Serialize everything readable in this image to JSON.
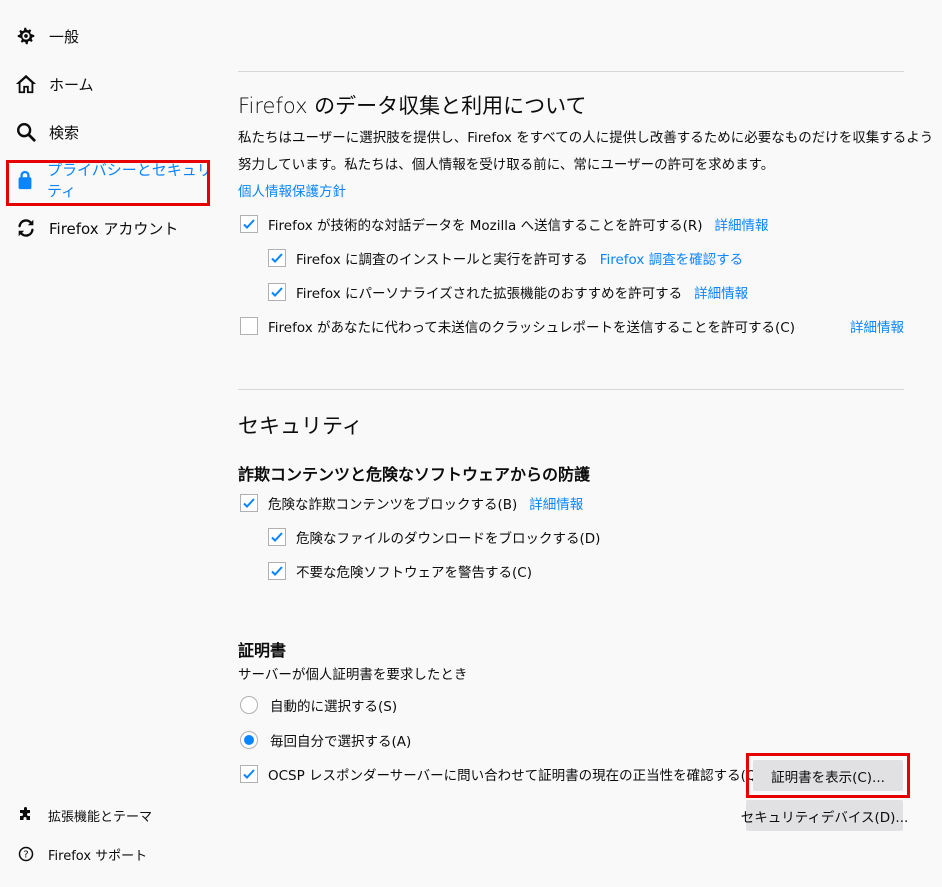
{
  "sidebar": {
    "items": [
      {
        "label": "一般",
        "icon": "gear-icon"
      },
      {
        "label": "ホーム",
        "icon": "home-icon"
      },
      {
        "label": "検索",
        "icon": "search-icon"
      },
      {
        "label": "プライバシーとセキュリティ",
        "icon": "lock-icon"
      },
      {
        "label": "Firefox アカウント",
        "icon": "sync-icon"
      }
    ],
    "footer": [
      {
        "label": "拡張機能とテーマ",
        "icon": "puzzle-icon"
      },
      {
        "label": "Firefox サポート",
        "icon": "help-icon"
      }
    ]
  },
  "data_collection": {
    "title": "Firefox のデータ収集と利用について",
    "desc_line1": "私たちはユーザーに選択肢を提供し、Firefox をすべての人に提供し改善するために必要なものだけを収集するよう",
    "desc_line2": "努力しています。私たちは、個人情報を受け取る前に、常にユーザーの許可を求めます。",
    "privacy_link": "個人情報保護方針",
    "telemetry": {
      "label": "Firefox が技術的な対話データを Mozilla へ送信することを許可する(R)",
      "link": "詳細情報",
      "checked": true
    },
    "studies": {
      "label": "Firefox に調査のインストールと実行を許可する",
      "link": "Firefox 調査を確認する",
      "checked": true
    },
    "recommend": {
      "label": "Firefox にパーソナライズされた拡張機能のおすすめを許可する",
      "link": "詳細情報",
      "checked": true
    },
    "crash": {
      "label": "Firefox があなたに代わって未送信のクラッシュレポートを送信することを許可する(C)",
      "link": "詳細情報",
      "checked": false
    }
  },
  "security": {
    "title": "セキュリティ",
    "phishing_title": "詐欺コンテンツと危険なソフトウェアからの防護",
    "block_deceptive": {
      "label": "危険な詐欺コンテンツをブロックする(B)",
      "link": "詳細情報",
      "checked": true
    },
    "block_downloads": {
      "label": "危険なファイルのダウンロードをブロックする(D)",
      "checked": true
    },
    "warn_unwanted": {
      "label": "不要な危険ソフトウェアを警告する(C)",
      "checked": true
    }
  },
  "certificates": {
    "title": "証明書",
    "subtitle": "サーバーが個人証明書を要求したとき",
    "auto_select": {
      "label": "自動的に選択する(S)",
      "selected": false
    },
    "ask_every": {
      "label": "毎回自分で選択する(A)",
      "selected": true
    },
    "ocsp": {
      "label": "OCSP レスポンダーサーバーに問い合わせて証明書の現在の正当性を確認する(Q)",
      "checked": true
    },
    "view_button": "証明書を表示(C)...",
    "devices_button": "セキュリティデバイス(D)..."
  },
  "colors": {
    "accent": "#0a84ff",
    "highlight": "#e60000",
    "background": "#f9f9fa"
  }
}
